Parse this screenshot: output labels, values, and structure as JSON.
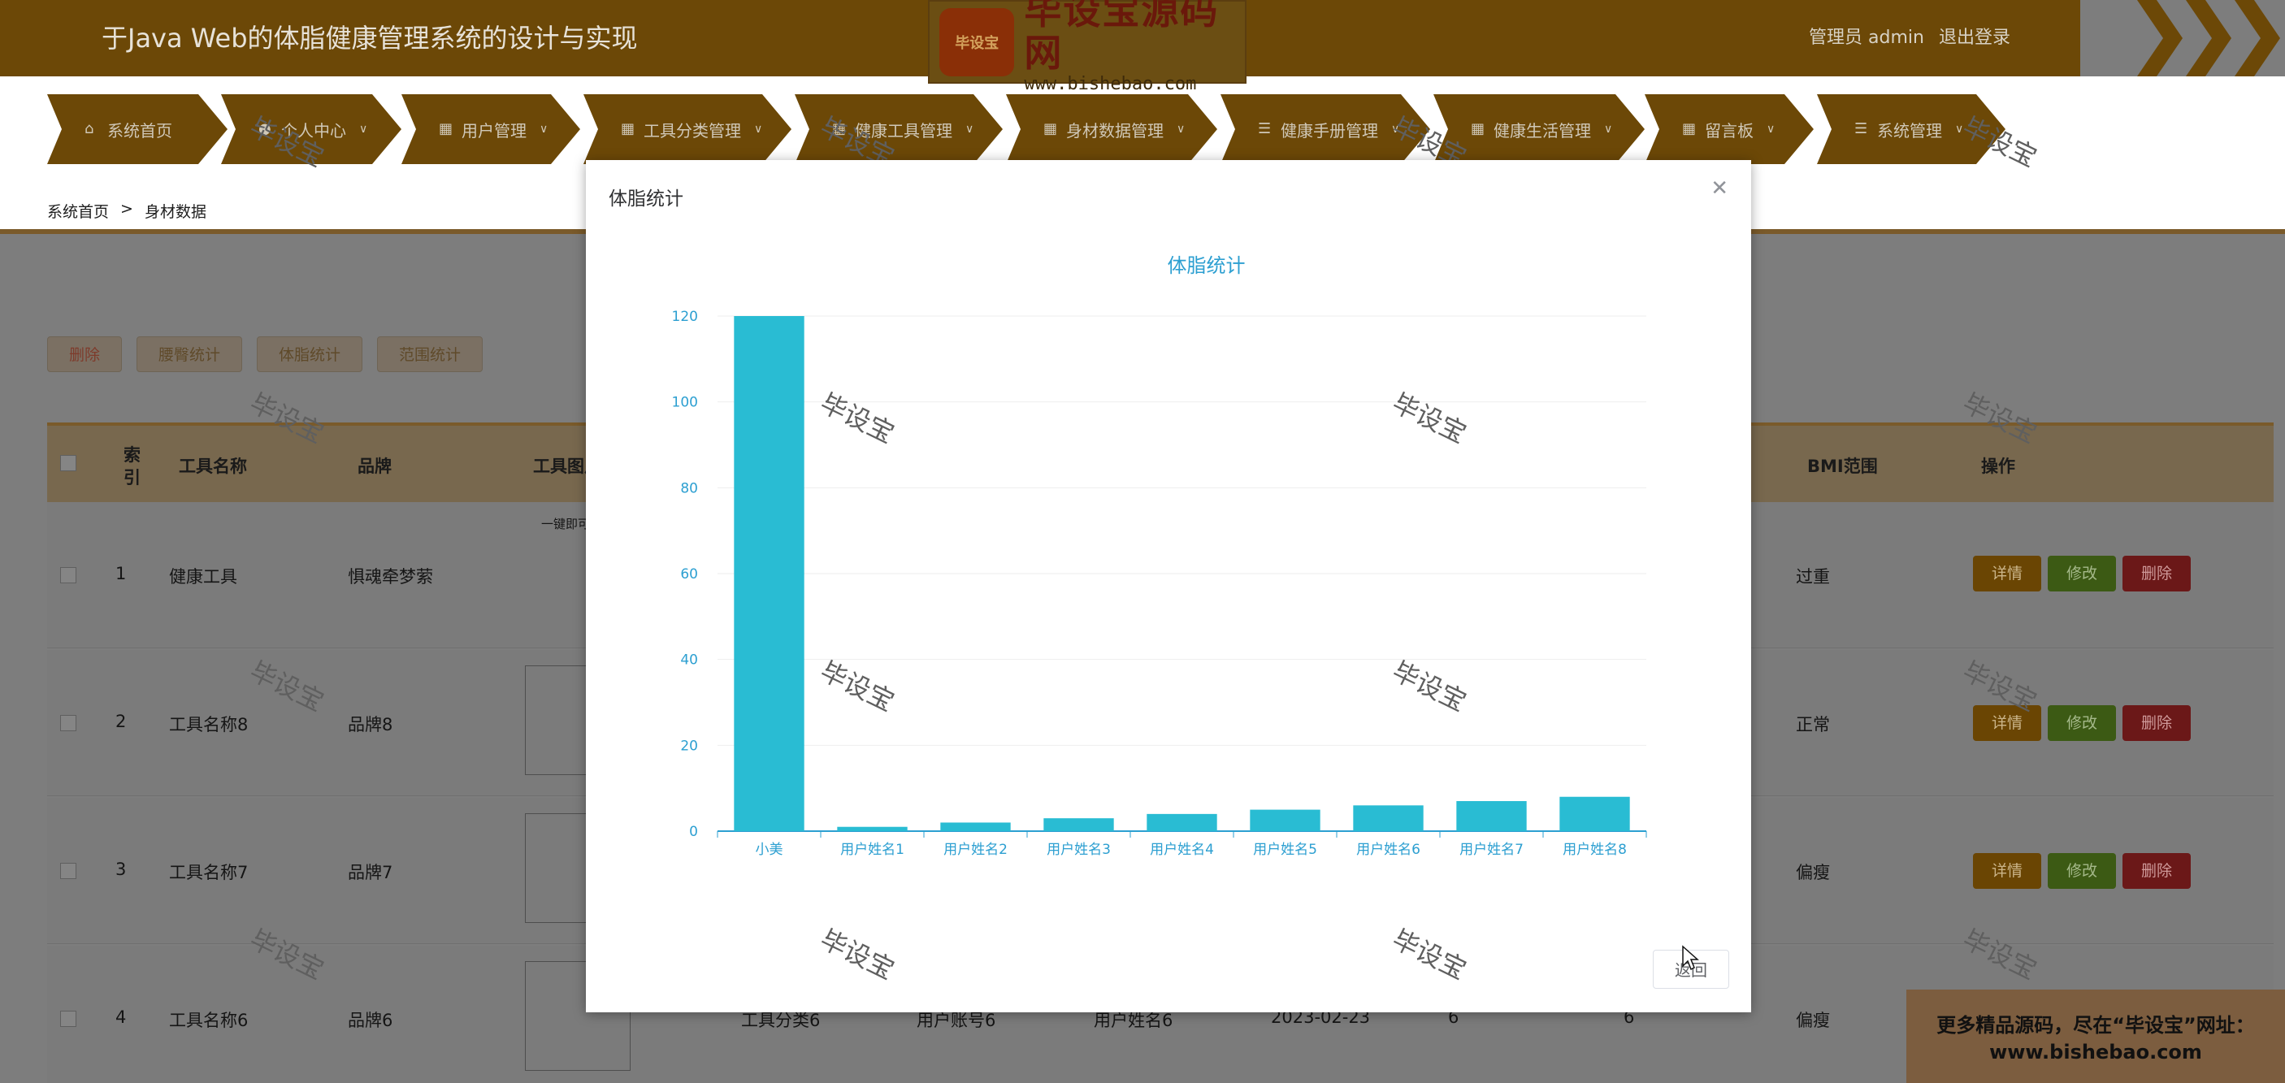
{
  "header": {
    "title": "于Java Web的体脂健康管理系统的设计与实现",
    "admin": "管理员 admin",
    "logout": "退出登录"
  },
  "logo": {
    "badge": "毕设宝",
    "title": "毕设宝源码网",
    "url": "www.bishebao.com"
  },
  "nav": [
    {
      "label": "系统首页",
      "icon": "home-icon"
    },
    {
      "label": "个人中心",
      "icon": "user-icon"
    },
    {
      "label": "用户管理",
      "icon": "grid-icon"
    },
    {
      "label": "工具分类管理",
      "icon": "grid-icon"
    },
    {
      "label": "健康工具管理",
      "icon": "grid-icon"
    },
    {
      "label": "身材数据管理",
      "icon": "grid-icon"
    },
    {
      "label": "健康手册管理",
      "icon": "list-icon"
    },
    {
      "label": "健康生活管理",
      "icon": "grid-icon"
    },
    {
      "label": "留言板",
      "icon": "grid-icon"
    },
    {
      "label": "系统管理",
      "icon": "list-icon"
    }
  ],
  "breadcrumb": {
    "home": "系统首页",
    "sep": ">",
    "current": "身材数据"
  },
  "actions": {
    "delete": "删除",
    "waist": "腰臀统计",
    "bodyfat": "体脂统计",
    "range": "范围统计"
  },
  "table": {
    "headers": {
      "index": "索引",
      "name": "工具名称",
      "brand": "品牌",
      "image": "工具图片",
      "bmi_range": "BMI范围",
      "ops": "操作"
    },
    "rows": [
      {
        "index": "1",
        "name": "健康工具",
        "brand": "惧魂牵梦萦",
        "bmi": "过重",
        "image_text": "一键即可"
      },
      {
        "index": "2",
        "name": "工具名称8",
        "brand": "品牌8",
        "bmi": "正常"
      },
      {
        "index": "3",
        "name": "工具名称7",
        "brand": "品牌7",
        "bmi": "偏瘦"
      },
      {
        "index": "4",
        "name": "工具名称6",
        "brand": "品牌6",
        "bmi": "偏瘦",
        "category": "工具分类6",
        "account": "用户账号6",
        "username": "用户姓名6",
        "date": "2023-02-23",
        "v1": "6",
        "v2": "6"
      }
    ],
    "ops": {
      "detail": "详情",
      "edit": "修改",
      "delete": "删除"
    }
  },
  "watermark": "毕设宝",
  "promo": {
    "line1": "更多精品源码，尽在“毕设宝”网址：",
    "line2": "www.bishebao.com"
  },
  "modal": {
    "title": "体脂统计",
    "back": "返回",
    "close_icon": "close-icon"
  },
  "chart_data": {
    "type": "bar",
    "title": "体脂统计",
    "categories": [
      "小美",
      "用户姓名1",
      "用户姓名2",
      "用户姓名3",
      "用户姓名4",
      "用户姓名5",
      "用户姓名6",
      "用户姓名7",
      "用户姓名8"
    ],
    "values": [
      120,
      1,
      2,
      3,
      4,
      5,
      6,
      7,
      8
    ],
    "ylim": [
      0,
      120
    ],
    "yticks": [
      0,
      20,
      40,
      60,
      80,
      100,
      120
    ],
    "xlabel": "",
    "ylabel": "",
    "bar_color": "#29bcd3",
    "title_color": "#2c9fd1",
    "grid": true
  },
  "colors": {
    "accent_orange": "#f39a0b",
    "dimmed_accent": "#6c4807"
  }
}
